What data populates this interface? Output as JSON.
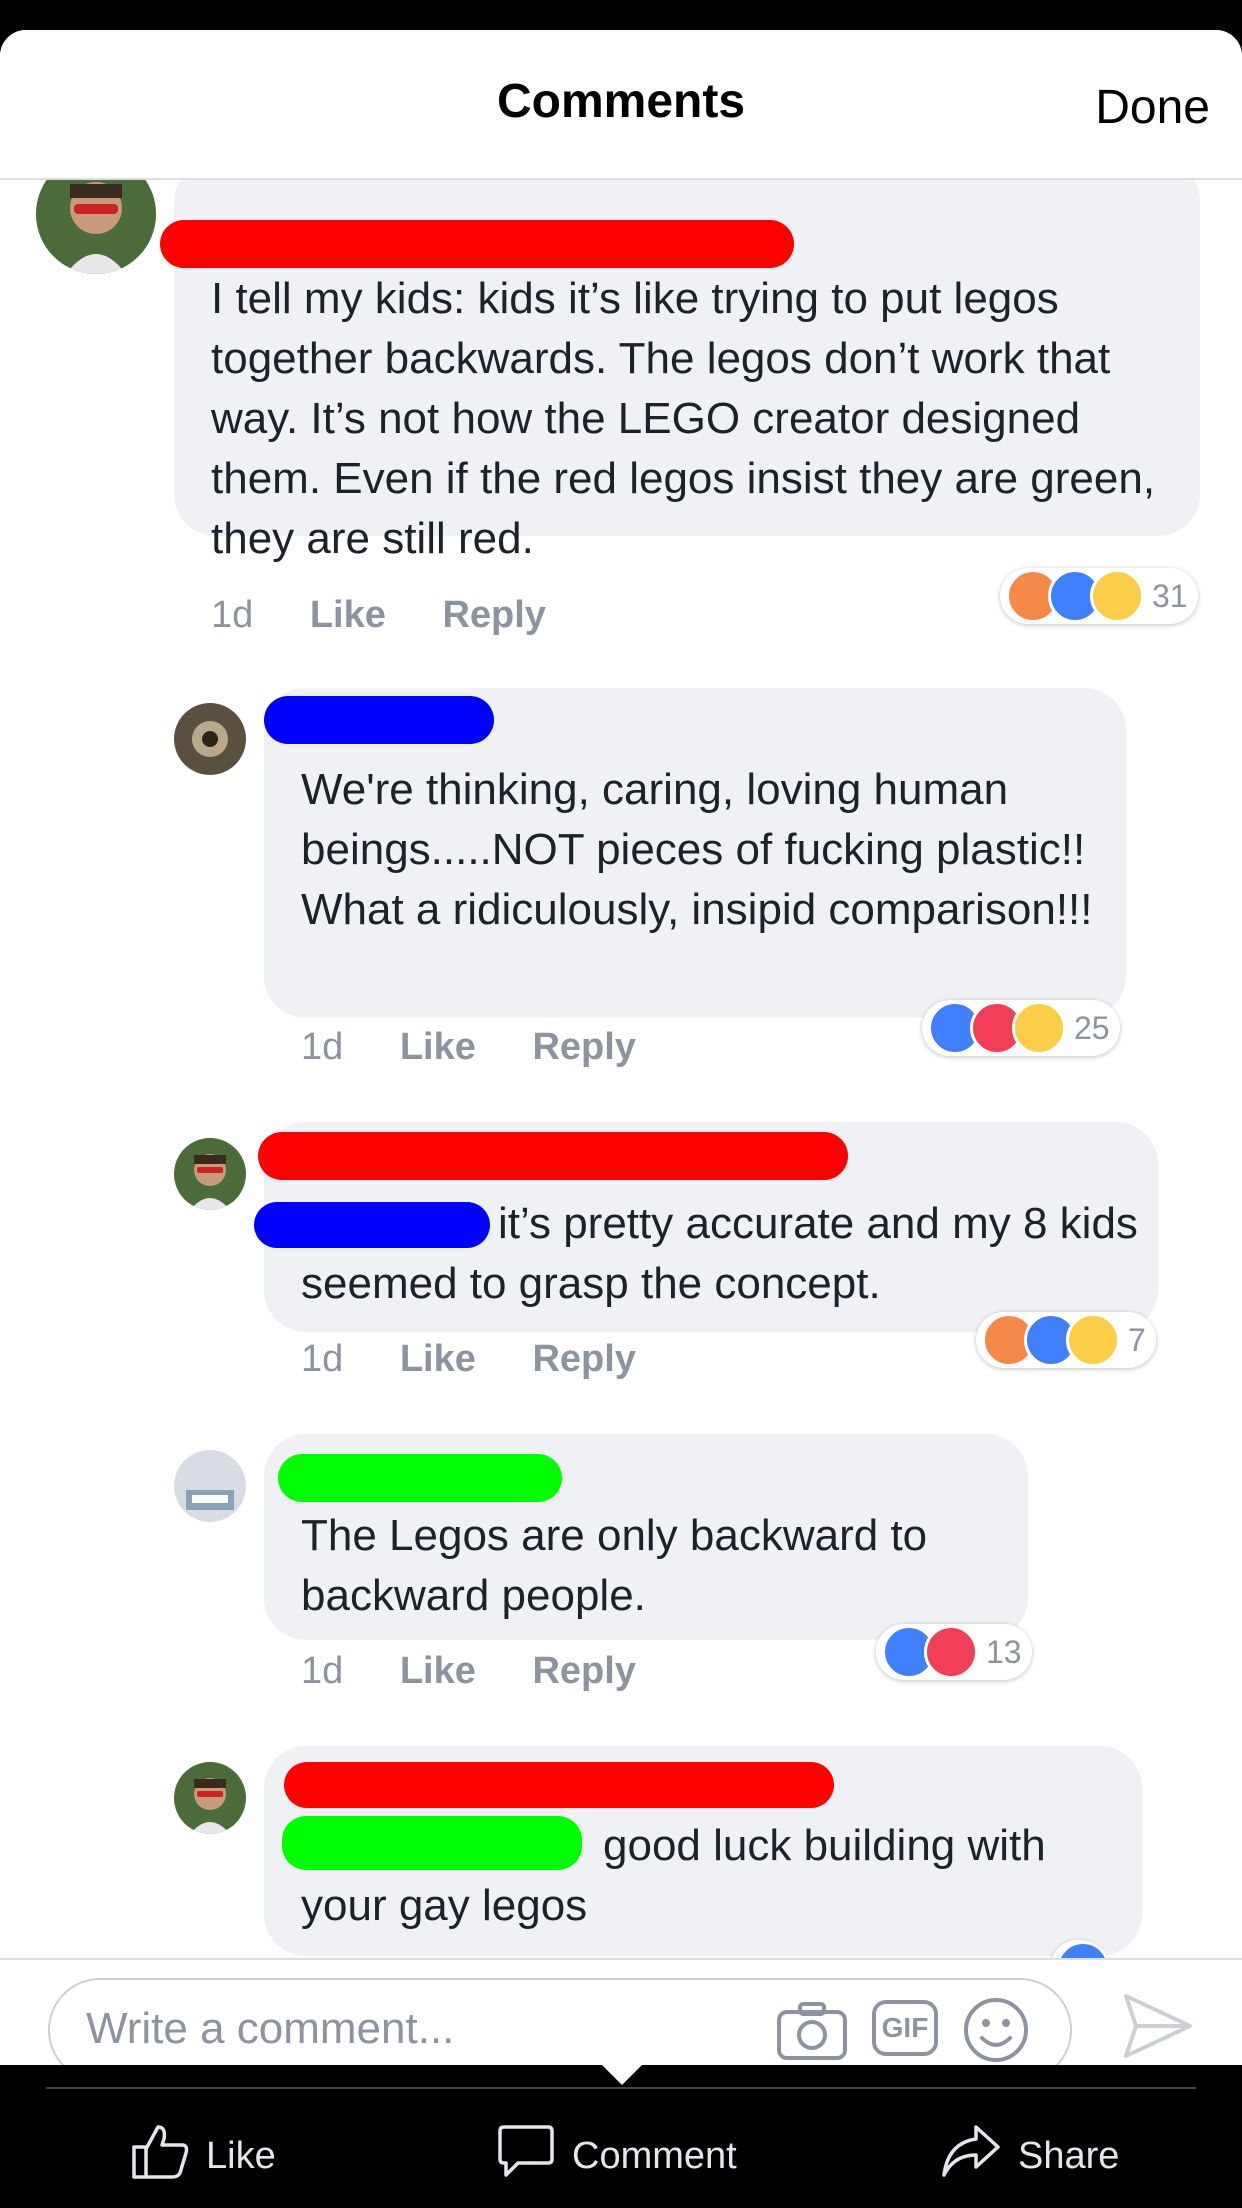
{
  "header": {
    "title": "Comments",
    "done_label": "Done"
  },
  "colors": {
    "redact_red": "#ff0000",
    "redact_blue": "#0000ff",
    "redact_green": "#00ff00",
    "like_blue": "#4080ff",
    "love_red": "#f33e58",
    "emoji_yellow": "#fbcd48"
  },
  "comments": [
    {
      "text": "I tell my kids: kids it’s like trying to put legos together backwards.  The legos don’t work that way. It’s not how the LEGO creator designed them. Even if the red legos insist they are green, they are still red.",
      "time": "1d",
      "like": "Like",
      "reply": "Reply",
      "reaction_count": "31",
      "reactions": [
        "angry",
        "like",
        "sad"
      ]
    },
    {
      "text": "We're thinking, caring, loving human beings.....NOT pieces of fucking plastic!! What a ridiculously, insipid comparison!!!",
      "time": "1d",
      "like": "Like",
      "reply": "Reply",
      "reaction_count": "25",
      "reactions": [
        "like",
        "love",
        "haha"
      ]
    },
    {
      "text": "it’s pretty accurate and my 8 kids seemed to grasp the concept.",
      "time": "1d",
      "like": "Like",
      "reply": "Reply",
      "reaction_count": "7",
      "reactions": [
        "angry",
        "like",
        "haha"
      ]
    },
    {
      "text": "The Legos are only backward to backward people.",
      "time": "1d",
      "like": "Like",
      "reply": "Reply",
      "reaction_count": "13",
      "reactions": [
        "like",
        "love"
      ]
    },
    {
      "text": "good luck building with your gay legos",
      "reactions": [
        "like"
      ]
    }
  ],
  "composer": {
    "placeholder": "Write a comment...",
    "icons": [
      "camera-icon",
      "gif-icon",
      "emoji-icon",
      "send-icon"
    ],
    "gif_label": "GIF"
  },
  "tabs": [
    {
      "label": "Like",
      "icon": "thumbs-up-icon"
    },
    {
      "label": "Comment",
      "icon": "speech-bubble-icon"
    },
    {
      "label": "Share",
      "icon": "share-arrow-icon"
    }
  ]
}
